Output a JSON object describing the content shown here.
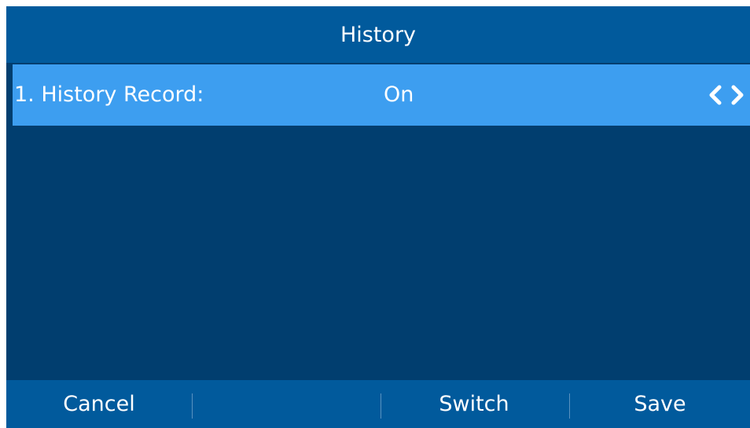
{
  "header": {
    "title": "History"
  },
  "list": {
    "items": [
      {
        "label": "1. History Record:",
        "value": "On"
      }
    ]
  },
  "softkeys": [
    "Cancel",
    "",
    "Switch",
    "Save"
  ],
  "colors": {
    "background": "#013e6f",
    "bar": "#015a9c",
    "selected_row": "#3d9ef0",
    "text": "#ffffff"
  },
  "icons": [
    "chevron-left-icon",
    "chevron-right-icon"
  ]
}
